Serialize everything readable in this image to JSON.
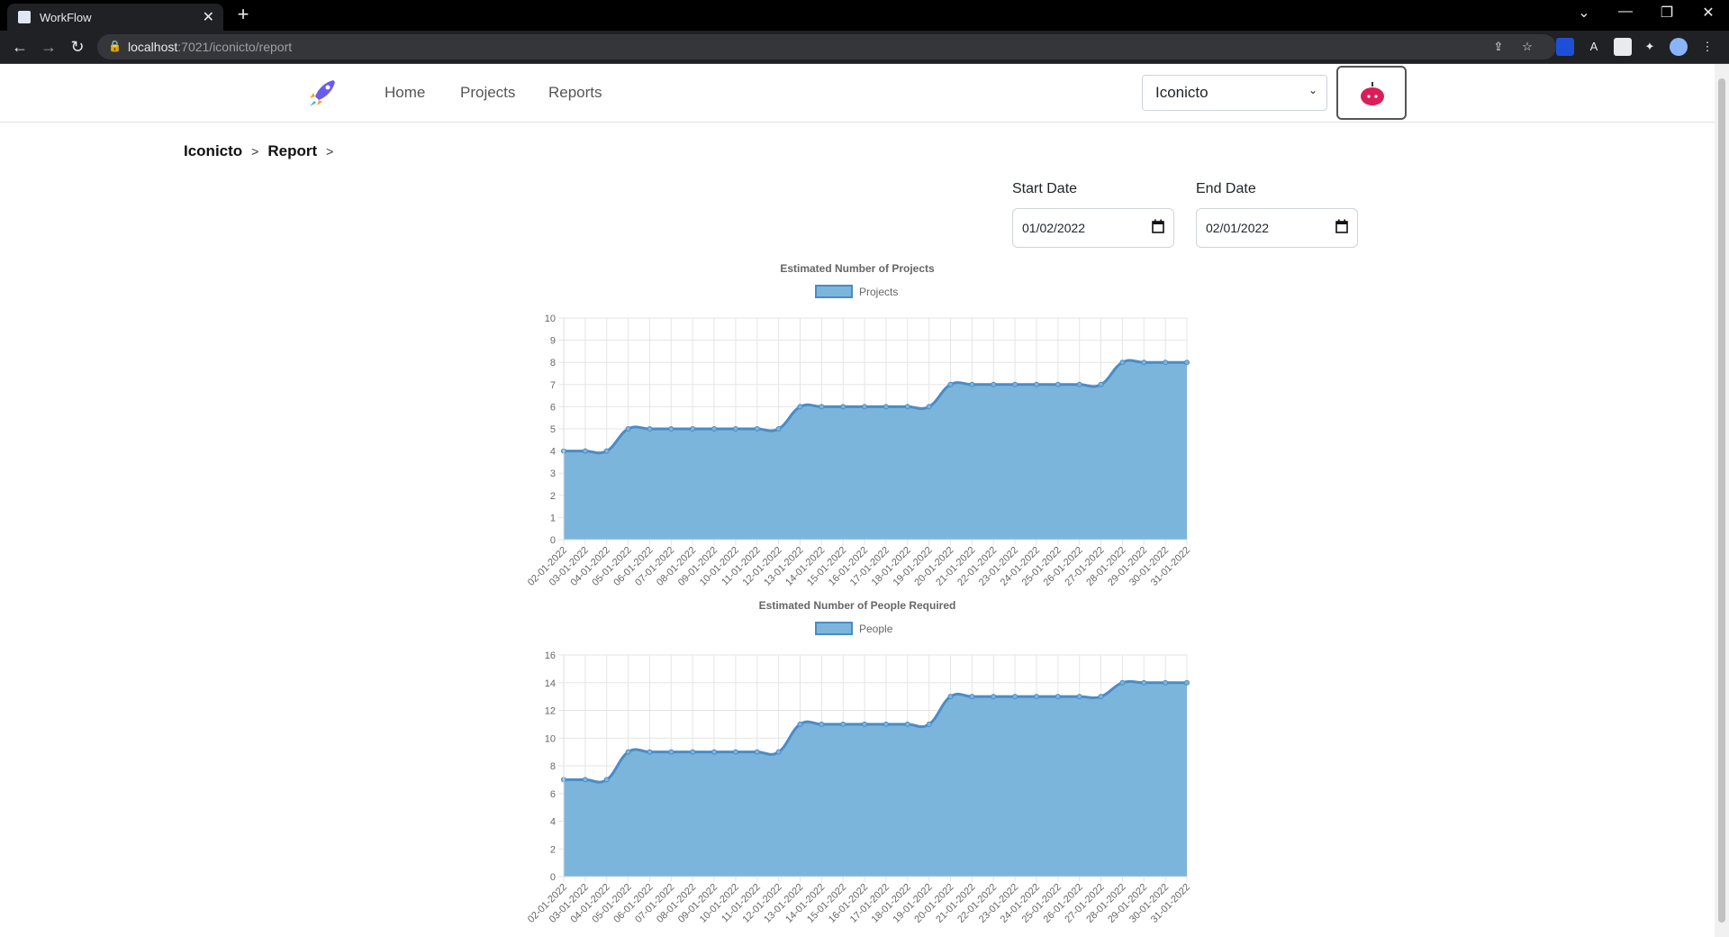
{
  "browser": {
    "tab_title": "WorkFlow",
    "tab_close": "✕",
    "new_tab": "+",
    "url_host": "localhost",
    "url_path": ":7021/iconicto/report",
    "lock_icon": "🔒",
    "back_icon": "←",
    "forward_icon": "→",
    "reload_icon": "↻",
    "win_controls": [
      "⌄",
      "—",
      "❐",
      "✕"
    ]
  },
  "navbar": {
    "links": [
      "Home",
      "Projects",
      "Reports"
    ],
    "org_select": "Iconicto",
    "select_chevron": "⌄"
  },
  "breadcrumb": {
    "items": [
      "Iconicto",
      "Report"
    ],
    "separator": ">"
  },
  "filters": {
    "start_label": "Start Date",
    "start_value": "01/02/2022",
    "end_label": "End Date",
    "end_value": "02/01/2022"
  },
  "colors": {
    "fill": "#7cb5dc",
    "line": "#4a8cc7",
    "accent_avatar": "#d91f59"
  },
  "chart_data": [
    {
      "type": "area",
      "title": "Estimated Number of Projects",
      "series": [
        {
          "name": "Projects",
          "values": [
            4,
            4,
            4,
            5,
            5,
            5,
            5,
            5,
            5,
            5,
            5,
            6,
            6,
            6,
            6,
            6,
            6,
            6,
            7,
            7,
            7,
            7,
            7,
            7,
            7,
            7,
            8,
            8,
            8,
            8
          ]
        }
      ],
      "x": [
        "02-01-2022",
        "03-01-2022",
        "04-01-2022",
        "05-01-2022",
        "06-01-2022",
        "07-01-2022",
        "08-01-2022",
        "09-01-2022",
        "10-01-2022",
        "11-01-2022",
        "12-01-2022",
        "13-01-2022",
        "14-01-2022",
        "15-01-2022",
        "16-01-2022",
        "17-01-2022",
        "18-01-2022",
        "19-01-2022",
        "20-01-2022",
        "21-01-2022",
        "22-01-2022",
        "23-01-2022",
        "24-01-2022",
        "25-01-2022",
        "26-01-2022",
        "27-01-2022",
        "28-01-2022",
        "29-01-2022",
        "30-01-2022",
        "31-01-2022"
      ],
      "ylim": [
        0,
        10
      ],
      "yticks": [
        0,
        1,
        2,
        3,
        4,
        5,
        6,
        7,
        8,
        9,
        10
      ],
      "grid": true,
      "legend": "top"
    },
    {
      "type": "area",
      "title": "Estimated Number of People Required",
      "series": [
        {
          "name": "People",
          "values": [
            7,
            7,
            7,
            9,
            9,
            9,
            9,
            9,
            9,
            9,
            9,
            11,
            11,
            11,
            11,
            11,
            11,
            11,
            13,
            13,
            13,
            13,
            13,
            13,
            13,
            13,
            14,
            14,
            14,
            14
          ]
        }
      ],
      "x": [
        "02-01-2022",
        "03-01-2022",
        "04-01-2022",
        "05-01-2022",
        "06-01-2022",
        "07-01-2022",
        "08-01-2022",
        "09-01-2022",
        "10-01-2022",
        "11-01-2022",
        "12-01-2022",
        "13-01-2022",
        "14-01-2022",
        "15-01-2022",
        "16-01-2022",
        "17-01-2022",
        "18-01-2022",
        "19-01-2022",
        "20-01-2022",
        "21-01-2022",
        "22-01-2022",
        "23-01-2022",
        "24-01-2022",
        "25-01-2022",
        "26-01-2022",
        "27-01-2022",
        "28-01-2022",
        "29-01-2022",
        "30-01-2022",
        "31-01-2022"
      ],
      "ylim": [
        0,
        16
      ],
      "yticks": [
        0,
        2,
        4,
        6,
        8,
        10,
        12,
        14,
        16
      ],
      "grid": true,
      "legend": "top"
    }
  ]
}
